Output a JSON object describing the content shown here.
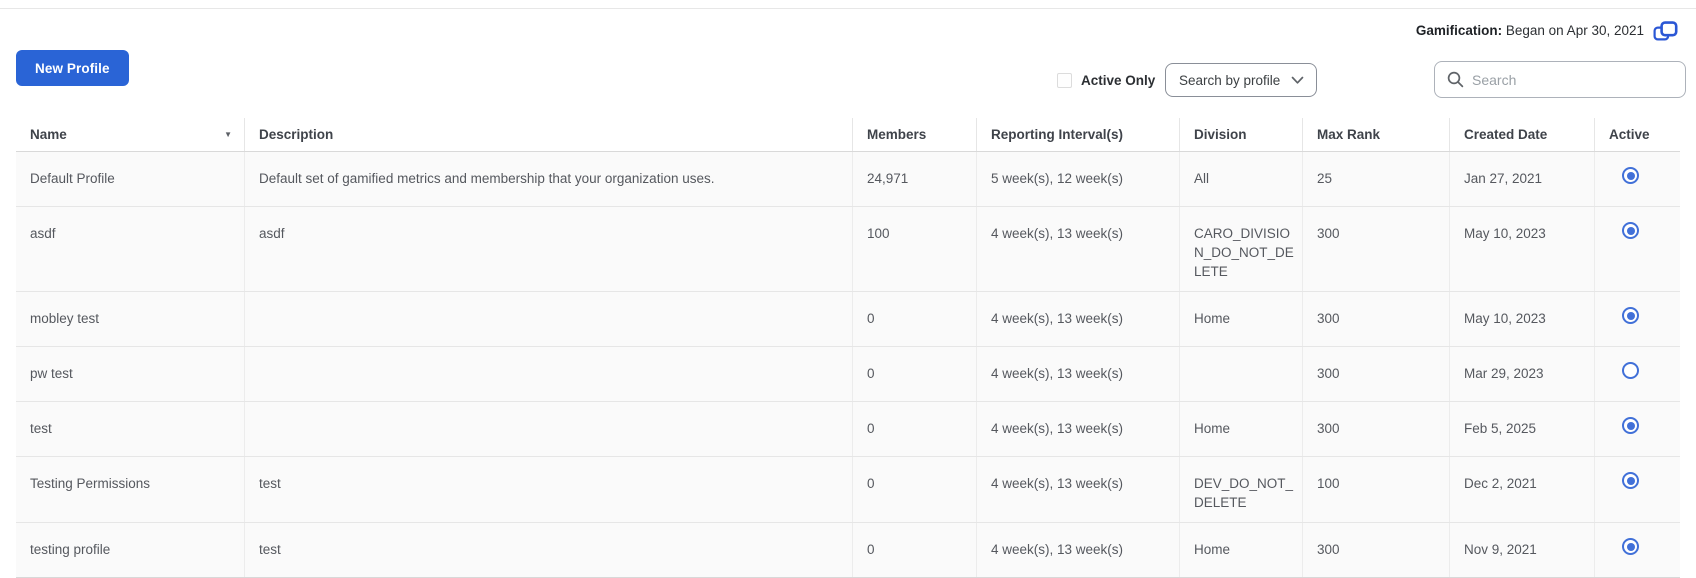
{
  "page": {
    "gamification_label": "Gamification:",
    "gamification_text": " Began on Apr 30, 2021"
  },
  "toolbar": {
    "new_profile_label": "New Profile",
    "active_only_label": "Active Only",
    "search_by_value": "Search by profile",
    "search_placeholder": "Search"
  },
  "colors": {
    "primary_button_blue": "#2a64d6",
    "radio_blue": "#4170d8",
    "icon_blue": "#2b57d5",
    "row_background": "#fafafa"
  },
  "table": {
    "columns": [
      "Name",
      "Description",
      "Members",
      "Reporting Interval(s)",
      "Division",
      "Max Rank",
      "Created Date",
      "Active"
    ],
    "rows": [
      {
        "name": "Default Profile",
        "description": "Default set of gamified metrics and membership that your organization uses.",
        "members": "24,971",
        "reporting": "5 week(s), 12 week(s)",
        "division": "All",
        "max_rank": "25",
        "created": "Jan 27, 2021",
        "active": true
      },
      {
        "name": "asdf",
        "description": "asdf",
        "members": "100",
        "reporting": "4 week(s), 13 week(s)",
        "division": "CARO_DIVISION_DO_NOT_DELETE",
        "max_rank": "300",
        "created": "May 10, 2023",
        "active": true
      },
      {
        "name": "mobley test",
        "description": "",
        "members": "0",
        "reporting": "4 week(s), 13 week(s)",
        "division": "Home",
        "max_rank": "300",
        "created": "May 10, 2023",
        "active": true
      },
      {
        "name": "pw test",
        "description": "",
        "members": "0",
        "reporting": "4 week(s), 13 week(s)",
        "division": "",
        "max_rank": "300",
        "created": "Mar 29, 2023",
        "active": false
      },
      {
        "name": "test",
        "description": "",
        "members": "0",
        "reporting": "4 week(s), 13 week(s)",
        "division": "Home",
        "max_rank": "300",
        "created": "Feb 5, 2025",
        "active": true
      },
      {
        "name": "Testing Permissions",
        "description": "test",
        "members": "0",
        "reporting": "4 week(s), 13 week(s)",
        "division": "DEV_DO_NOT_DELETE",
        "max_rank": "100",
        "created": "Dec 2, 2021",
        "active": true
      },
      {
        "name": "testing profile",
        "description": "test",
        "members": "0",
        "reporting": "4 week(s), 13 week(s)",
        "division": "Home",
        "max_rank": "300",
        "created": "Nov 9, 2021",
        "active": true
      }
    ]
  }
}
